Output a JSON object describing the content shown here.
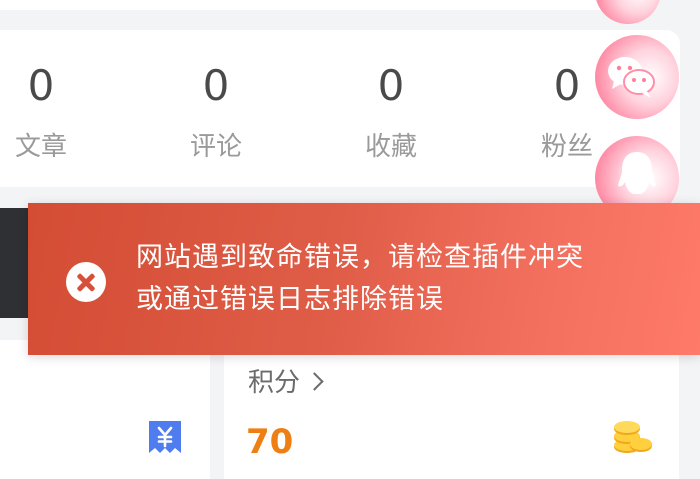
{
  "stats": [
    {
      "value": "0",
      "label": "文章"
    },
    {
      "value": "0",
      "label": "评论"
    },
    {
      "value": "0",
      "label": "收藏"
    },
    {
      "value": "0",
      "label": "粉丝"
    }
  ],
  "points": {
    "label": "积分",
    "value": "70"
  },
  "toast": {
    "line1": "网站遇到致命错误，请检查插件冲突",
    "line2": "或通过错误日志排除错误"
  },
  "icons": {
    "error": "close-circle-icon",
    "wechat": "wechat-icon",
    "qq": "qq-icon",
    "voucher": "voucher-icon",
    "coins": "coin-stack-icon"
  },
  "colors": {
    "toast_start": "#d44c34",
    "toast_end": "#ff7a68",
    "points_value": "#f07f13",
    "side_button": "#ff6f8f"
  }
}
